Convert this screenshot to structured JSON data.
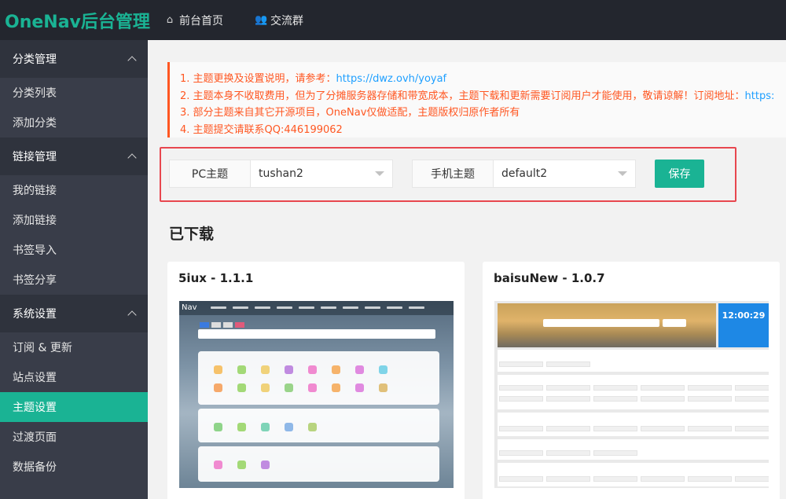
{
  "app": {
    "logo": "OneNav后台管理",
    "topnav": [
      {
        "label": "前台首页",
        "icon": "home-icon"
      },
      {
        "label": "交流群",
        "icon": "users-icon"
      }
    ]
  },
  "sidebar": {
    "groups": [
      {
        "label": "分类管理",
        "items": [
          "分类列表",
          "添加分类"
        ]
      },
      {
        "label": "链接管理",
        "items": [
          "我的链接",
          "添加链接",
          "书签导入",
          "书签分享"
        ]
      },
      {
        "label": "系统设置",
        "items": [
          "订阅 & 更新",
          "站点设置",
          "主题设置",
          "过渡页面",
          "数据备份"
        ]
      }
    ],
    "active_item": "主题设置"
  },
  "notice": {
    "line1_text": "1. 主题更换及设置说明，请参考：",
    "line1_link": "https://dwz.ovh/yoyaf",
    "line2_text": "2. 主题本身不收取费用，但为了分摊服务器存储和带宽成本，主题下载和更新需要订阅用户才能使用，敬请谅解！订阅地址：",
    "line2_link": "https:",
    "line3": "3. 部分主题来自其它开源项目，OneNav仅做适配，主题版权归原作者所有",
    "line4": "4. 主题提交请联系QQ:446199062"
  },
  "theme_form": {
    "pc_label": "PC主题",
    "pc_value": "tushan2",
    "mobile_label": "手机主题",
    "mobile_value": "default2",
    "save_label": "保存"
  },
  "downloaded": {
    "title": "已下载",
    "themes": [
      {
        "name": "5iux - 1.1.1"
      },
      {
        "name": "baisuNew - 1.0.7",
        "preview_clock": "12:00:29"
      }
    ]
  },
  "colors": {
    "accent": "#1ab394",
    "sidebar_bg": "#393d49",
    "header_bg": "#23262e",
    "notice_text": "#ff5722",
    "link": "#1e9fff",
    "highlight_border": "#e8474f"
  }
}
